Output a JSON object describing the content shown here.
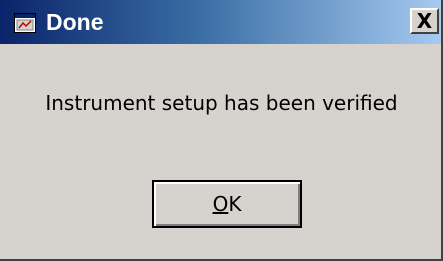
{
  "window": {
    "title": "Done",
    "icon": "labview-app-icon",
    "close_label": "X",
    "close_icon": "close-icon"
  },
  "dialog": {
    "message": "Instrument setup has been verified",
    "ok_button": {
      "mnemonic": "O",
      "rest": "K"
    }
  },
  "colors": {
    "titlebar_start": "#0a246a",
    "titlebar_end": "#a6caf0",
    "dialog_background": "#d6d3ce",
    "title_text": "#ffffff"
  }
}
